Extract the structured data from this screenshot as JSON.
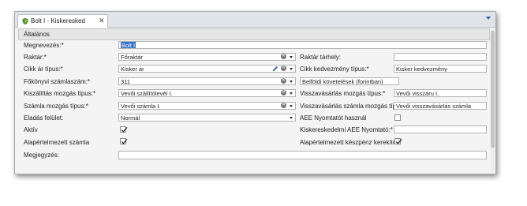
{
  "tab": {
    "label": "Bolt I - Kiskeresked",
    "close_icon": "✕"
  },
  "group": {
    "title": "Általános"
  },
  "fields": {
    "megnevezes": {
      "label": "Megnevezés:*",
      "value": "Bolt I"
    },
    "raktar": {
      "label": "Raktár:*",
      "value": "Főraktár"
    },
    "raktar_tarhely": {
      "label": "Raktár tárhely:",
      "value": ""
    },
    "cikk_ar_tipus": {
      "label": "Cikk ár típus:*",
      "value": "Kisker ár"
    },
    "cikk_kedvezmeny_tipus": {
      "label": "Cikk kedvezmény típus:*",
      "value": "Kisker kedvezmény"
    },
    "fokonyvi_szamlaszam": {
      "label": "Főkönyvi számlaszám:*",
      "value": "311"
    },
    "fokonyvi_szamlaszam_desc": {
      "value": "Belföldi követelések (forintban)"
    },
    "kiszallitas_mozgas_tipus": {
      "label": "Kiszállítás mozgás típus:*",
      "value": "Vevői szállítólevél I."
    },
    "visszavasarlas_mozgas_tipus": {
      "label": "Visszavásárlás mozgás típus:*",
      "value": "Vevői visszáru I."
    },
    "szamla_mozgas_tipus": {
      "label": "Számla mozgás típus:*",
      "value": "Vevői számla I."
    },
    "visszavasarlas_szamla_mozgas_tipus": {
      "label": "Visszavásárlás számla mozgás típus:*",
      "value": "Vevői visszavásárlás számla"
    },
    "eladas_felulet": {
      "label": "Eladás felület:",
      "value": "Normál"
    },
    "aee_nyomtatot_hasznal": {
      "label": "AEE Nyomtatót használ",
      "checked": false
    },
    "aktiv": {
      "label": "Aktív",
      "checked": true
    },
    "kiskereskedelmi_aee_nyomtato": {
      "label": "Kiskereskedelmi AEE Nyomtató:*",
      "value": ""
    },
    "alapertelmezett_szamla": {
      "label": "Alapértelmezett számla",
      "checked": true
    },
    "alapertelmezett_keszpenz_kerekites": {
      "label": "Alapértelmezett készpénz kerekítés",
      "checked": true
    },
    "megjegyzes": {
      "label": "Megjegyzés:",
      "value": ""
    }
  },
  "icons": {
    "clear": "✕",
    "accent": "#3470c8"
  }
}
